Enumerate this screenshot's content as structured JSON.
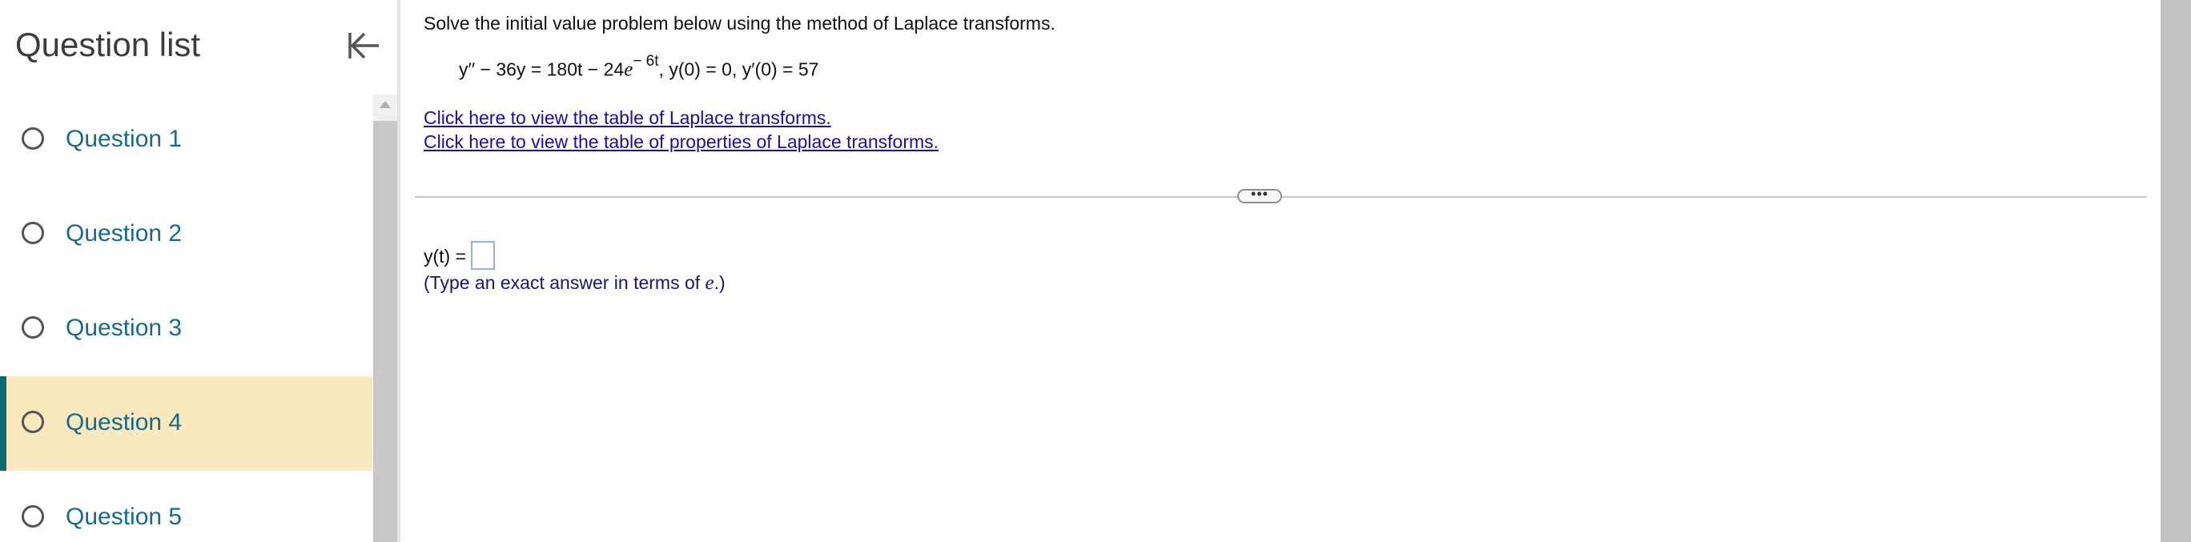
{
  "sidebar": {
    "title": "Question list",
    "collapse_icon": "collapse-left-icon",
    "questions": [
      {
        "label": "Question 1"
      },
      {
        "label": "Question 2"
      },
      {
        "label": "Question 3"
      },
      {
        "label": "Question 4"
      },
      {
        "label": "Question 5"
      }
    ],
    "active_index": 3
  },
  "main": {
    "instruction": "Solve the initial value problem below using the method of Laplace transforms.",
    "equation": {
      "lhs": "y′′ − 36y = 180t − 24",
      "e": "e",
      "exponent": "− 6t",
      "conditions": ", y(0) = 0, y′(0) = 57"
    },
    "link_table": "Click here to view the table of Laplace transforms.",
    "link_properties": "Click here to view the table of properties of Laplace transforms.",
    "more_label": "•••",
    "answer_label": "y(t) =",
    "answer_value": "",
    "hint_prefix": "(Type an exact answer in terms of ",
    "hint_e": "e",
    "hint_suffix": ".)"
  },
  "colors": {
    "active_bg": "#f9e9bd",
    "active_bar": "#0b6c73",
    "question_text": "#146b8f",
    "link": "#1a0dab",
    "hint": "#16157a"
  }
}
